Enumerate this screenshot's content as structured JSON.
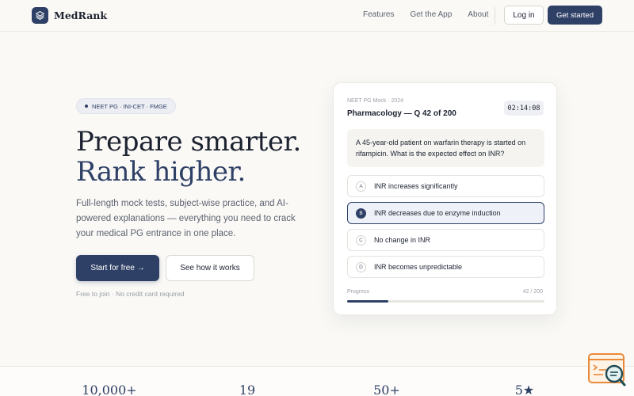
{
  "nav": {
    "brand": "MedRank",
    "links": [
      "Features",
      "Get the App",
      "About"
    ],
    "login": "Log in",
    "get_started": "Get started"
  },
  "hero": {
    "pill": "NEET PG · INI-CET · FMGE",
    "title_line1": "Prepare smarter.",
    "title_line2": "Rank higher.",
    "description": "Full-length mock tests, subject-wise practice, and AI-powered explanations — everything you need to crack your medical PG entrance in one place.",
    "cta_primary": "Start for free →",
    "cta_secondary": "See how it works",
    "note": "Free to join · No credit card required"
  },
  "card": {
    "subtitle": "NEET PG Mock · 2024",
    "title": "Pharmacology — Q 42 of 200",
    "timer": "02:14:08",
    "question": "A 45-year-old patient on warfarin therapy is started on rifampicin. What is the expected effect on INR?",
    "options": [
      {
        "letter": "A",
        "text": "INR increases significantly",
        "selected": false
      },
      {
        "letter": "B",
        "text": "INR decreases due to enzyme induction",
        "selected": true
      },
      {
        "letter": "C",
        "text": "No change in INR",
        "selected": false
      },
      {
        "letter": "D",
        "text": "INR becomes unpredictable",
        "selected": false
      }
    ],
    "progress_label": "Progress",
    "progress_count": "42 / 200",
    "progress_fraction": 0.21
  },
  "stats": [
    "10,000+",
    "19",
    "50+",
    "5★"
  ],
  "colors": {
    "accent": "#2f4066",
    "background": "#faf9f6",
    "text": "#1c2230",
    "muted": "#5d6370"
  }
}
